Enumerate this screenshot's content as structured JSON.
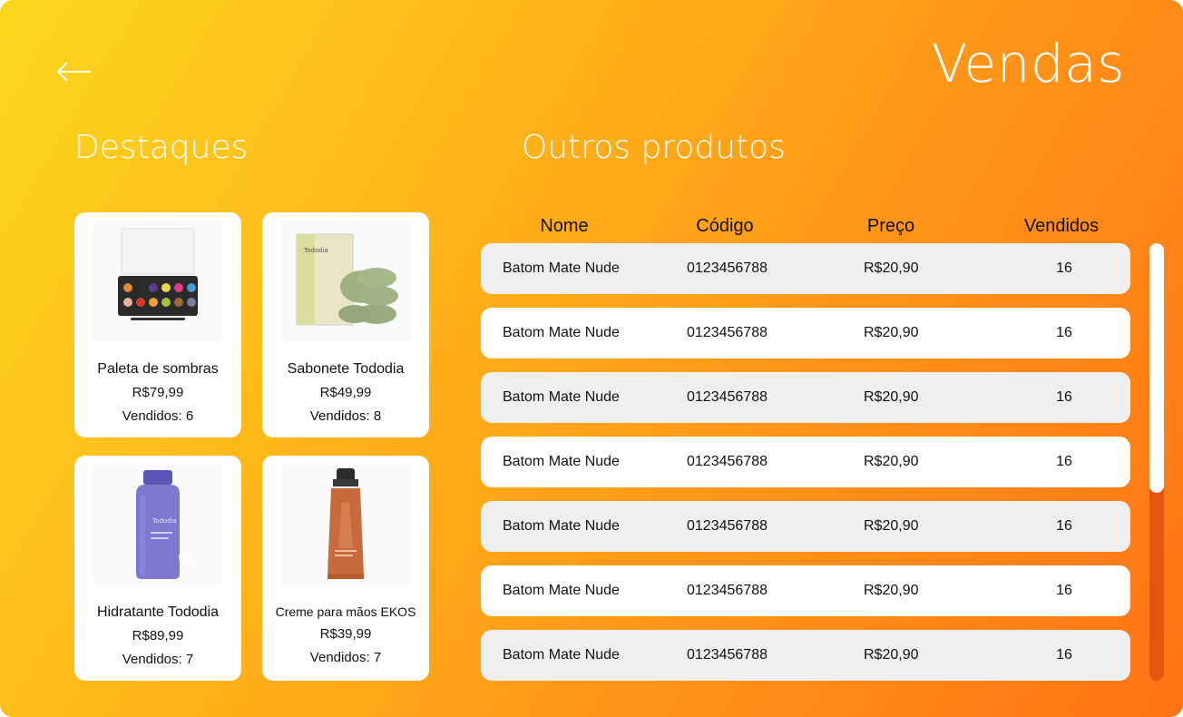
{
  "header": {
    "back_icon": "arrow-left-icon",
    "title": "Vendas"
  },
  "sections": {
    "featured_title": "Destaques",
    "others_title": "Outros produtos"
  },
  "featured": [
    {
      "name": "Paleta de sombras",
      "price": "R$79,99",
      "sold": "Vendidos: 6",
      "image": "eyeshadow-palette-image"
    },
    {
      "name": "Sabonete Tododia",
      "price": "R$49,99",
      "sold": "Vendidos: 8",
      "image": "soap-bars-image"
    },
    {
      "name": "Hidratante Tododia",
      "price": "R$89,99",
      "sold": "Vendidos: 7",
      "image": "lotion-bottle-image"
    },
    {
      "name": "Creme para mãos EKOS",
      "price": "R$39,99",
      "sold": "Vendidos: 7",
      "image": "hand-cream-tube-image"
    }
  ],
  "table": {
    "columns": [
      "Nome",
      "Código",
      "Preço",
      "Vendidos"
    ],
    "rows": [
      {
        "nome": "Batom Mate Nude",
        "codigo": "0123456788",
        "preco": "R$20,90",
        "vendidos": "16"
      },
      {
        "nome": "Batom Mate Nude",
        "codigo": "0123456788",
        "preco": "R$20,90",
        "vendidos": "16"
      },
      {
        "nome": "Batom Mate Nude",
        "codigo": "0123456788",
        "preco": "R$20,90",
        "vendidos": "16"
      },
      {
        "nome": "Batom Mate Nude",
        "codigo": "0123456788",
        "preco": "R$20,90",
        "vendidos": "16"
      },
      {
        "nome": "Batom Mate Nude",
        "codigo": "0123456788",
        "preco": "R$20,90",
        "vendidos": "16"
      },
      {
        "nome": "Batom Mate Nude",
        "codigo": "0123456788",
        "preco": "R$20,90",
        "vendidos": "16"
      },
      {
        "nome": "Batom Mate Nude",
        "codigo": "0123456788",
        "preco": "R$20,90",
        "vendidos": "16"
      }
    ]
  },
  "colors": {
    "gradient_start": "#fdd71e",
    "gradient_end": "#ff7416",
    "row_alt": "#efefef",
    "row_plain": "#ffffff",
    "scroll_track": "#e4560d",
    "scroll_thumb": "#ffffff"
  },
  "scroll": {
    "visible_fraction": 0.57,
    "position": 0
  }
}
